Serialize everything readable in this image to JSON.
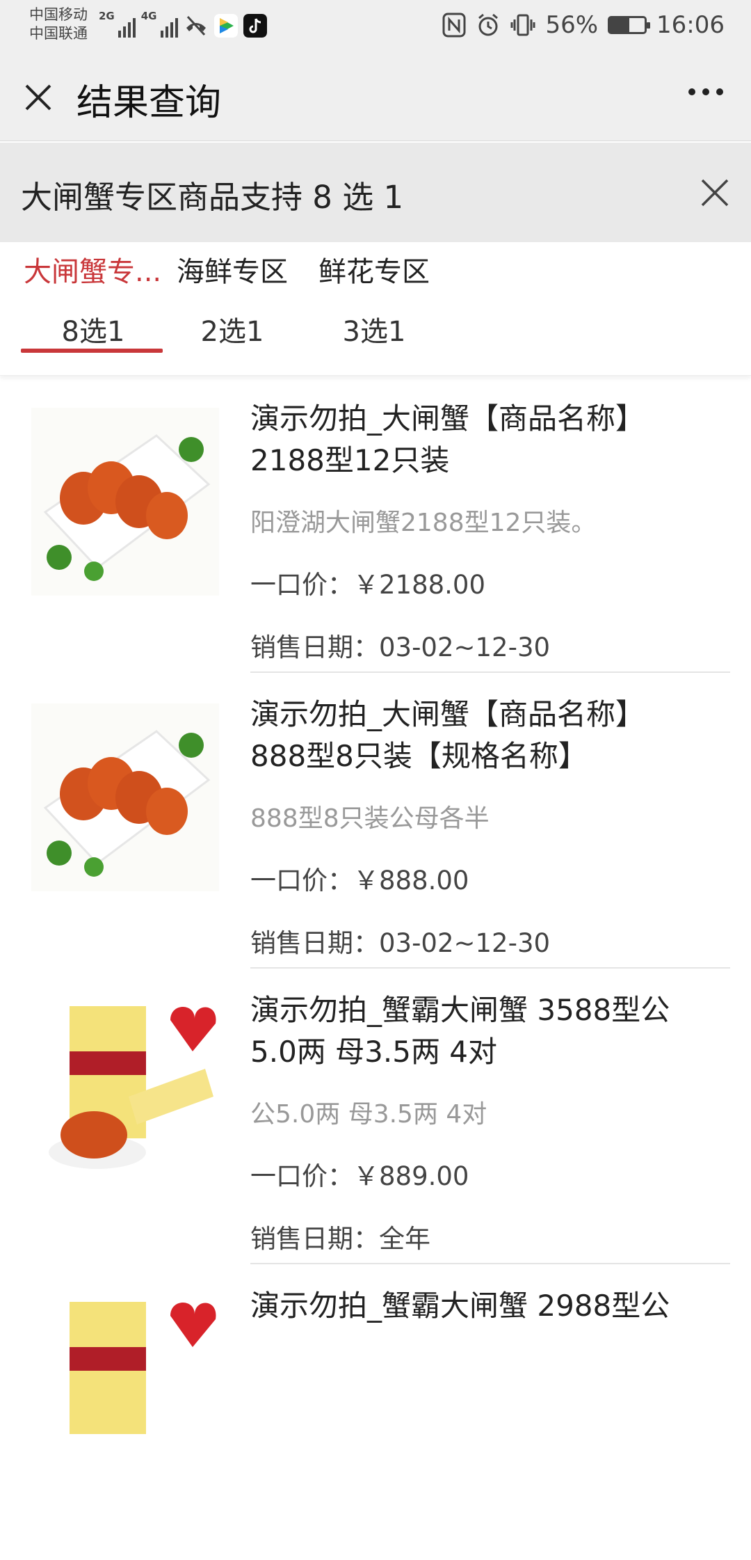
{
  "status_bar": {
    "carrier1": "中国移动",
    "carrier2": "中国联通",
    "net1": "2G",
    "net2": "4G",
    "battery_text": "56%",
    "battery_level": 0.56,
    "time": "16:06"
  },
  "nav": {
    "title": "结果查询"
  },
  "banner": {
    "text": "大闸蟹专区商品支持 8 选 1"
  },
  "tabs": [
    {
      "label": "大闸蟹专...",
      "sub": "8选1",
      "active": true
    },
    {
      "label": "海鲜专区",
      "sub": "2选1",
      "active": false
    },
    {
      "label": "鲜花专区",
      "sub": "3选1",
      "active": false
    }
  ],
  "items": [
    {
      "name": "演示勿拍_大闸蟹【商品名称】 2188型12只装",
      "desc": "阳澄湖大闸蟹2188型12只装。",
      "price": "一口价：￥2188.00",
      "date": "销售日期：03-02~12-30",
      "image": "crab-plate-image"
    },
    {
      "name": "演示勿拍_大闸蟹【商品名称】 888型8只装【规格名称】",
      "desc": "888型8只装公母各半",
      "price": "一口价：￥888.00",
      "date": "销售日期：03-02~12-30",
      "image": "crab-plate-image"
    },
    {
      "name": "演示勿拍_蟹霸大闸蟹 3588型公5.0两 母3.5两 4对",
      "desc": "公5.0两 母3.5两 4对",
      "price": "一口价：￥889.00",
      "date": "销售日期：全年",
      "image": "crab-giftbox-image"
    },
    {
      "name": "演示勿拍_蟹霸大闸蟹 2988型公",
      "desc": "",
      "price": "",
      "date": "",
      "image": "crab-giftbox-image"
    }
  ],
  "colors": {
    "accent": "#c9373a",
    "bar_bg": "#efefef",
    "banner_bg": "#e9e9e9"
  }
}
